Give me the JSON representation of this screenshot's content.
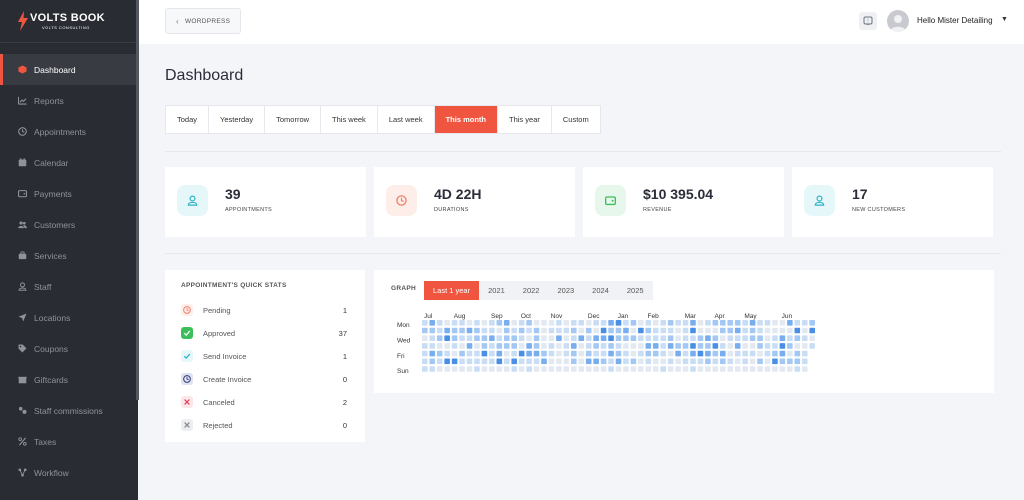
{
  "sidebar": {
    "brand": "VOLTS BOOK",
    "brand_sub": "VOLTS CONSULTING",
    "items": [
      {
        "label": "Dashboard",
        "icon": "cube-icon",
        "active": true
      },
      {
        "label": "Reports",
        "icon": "chart-icon"
      },
      {
        "label": "Appointments",
        "icon": "clock-icon"
      },
      {
        "label": "Calendar",
        "icon": "calendar-icon"
      },
      {
        "label": "Payments",
        "icon": "wallet-icon"
      },
      {
        "label": "Customers",
        "icon": "users-icon"
      },
      {
        "label": "Services",
        "icon": "services-icon"
      },
      {
        "label": "Staff",
        "icon": "user-icon"
      },
      {
        "label": "Locations",
        "icon": "location-icon"
      },
      {
        "label": "Coupons",
        "icon": "tag-icon"
      },
      {
        "label": "Giftcards",
        "icon": "gift-icon"
      },
      {
        "label": "Staff commissions",
        "icon": "commission-icon"
      },
      {
        "label": "Taxes",
        "icon": "percent-icon"
      },
      {
        "label": "Workflow",
        "icon": "workflow-icon"
      }
    ]
  },
  "topbar": {
    "wordpress_label": "WORDPRESS",
    "user_name": "Hello Mister Detailing"
  },
  "main": {
    "title": "Dashboard",
    "tabs": [
      "Today",
      "Yesterday",
      "Tomorrow",
      "This week",
      "Last week",
      "This month",
      "This year",
      "Custom"
    ],
    "active_tab": "This month",
    "cards": [
      {
        "value": "39",
        "label": "APPOINTMENTS",
        "icon": "user-icon",
        "color": "#2fb3c9",
        "bg": "#e6f7fa"
      },
      {
        "value": "4D 22H",
        "label": "DURATIONS",
        "icon": "clock-icon",
        "color": "#f0806a",
        "bg": "#fdeeea"
      },
      {
        "value": "$10 395.04",
        "label": "REVENUE",
        "icon": "wallet-icon",
        "color": "#3cbf5a",
        "bg": "#e8f7ec"
      },
      {
        "value": "17",
        "label": "NEW CUSTOMERS",
        "icon": "user-icon",
        "color": "#2fb3c9",
        "bg": "#e6f7fa"
      }
    ],
    "quick_stats": {
      "title": "APPOINTMENT'S QUICK STATS",
      "rows": [
        {
          "label": "Pending",
          "value": "1",
          "icon": "clock-icon",
          "color": "#f0806a",
          "bg": "#fdeeea"
        },
        {
          "label": "Approved",
          "value": "37",
          "icon": "check-icon",
          "color": "#ffffff",
          "bg": "#3cbf5a"
        },
        {
          "label": "Send Invoice",
          "value": "1",
          "icon": "check-icon",
          "color": "#2fb3c9",
          "bg": "#e6f7fa"
        },
        {
          "label": "Create Invoice",
          "value": "0",
          "icon": "clock-icon",
          "color": "#2f3a7a",
          "bg": "#dfe2f0"
        },
        {
          "label": "Canceled",
          "value": "2",
          "icon": "x-icon",
          "color": "#e0455a",
          "bg": "#fce6ea"
        },
        {
          "label": "Rejected",
          "value": "0",
          "icon": "x-icon",
          "color": "#888888",
          "bg": "#eceef1"
        }
      ]
    },
    "graph": {
      "label": "GRAPH",
      "year_tabs": [
        "Last 1 year",
        "2021",
        "2022",
        "2023",
        "2024",
        "2025"
      ],
      "active_year": "Last 1 year"
    }
  },
  "chart_data": {
    "type": "heatmap",
    "months": [
      "Jul",
      "Aug",
      "Sep",
      "Oct",
      "Nov",
      "Dec",
      "Jan",
      "Feb",
      "Mar",
      "Apr",
      "May",
      "Jun"
    ],
    "day_labels": [
      "Mon",
      "Wed",
      "Fri",
      "Sun"
    ],
    "rows": 7,
    "weeks": 53,
    "colors": [
      "#e3e9f1",
      "#c9ddf5",
      "#a3c8f3",
      "#78aef0",
      "#4a8fe6"
    ]
  }
}
